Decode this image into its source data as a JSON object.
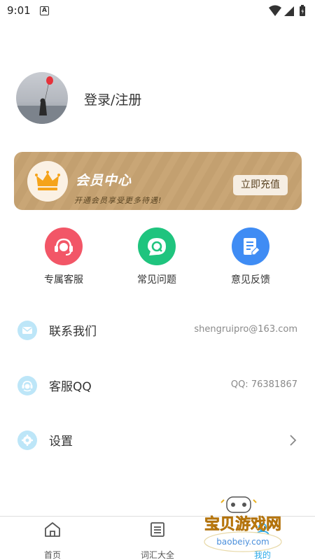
{
  "status_bar": {
    "time": "9:01",
    "notification_badge": "A"
  },
  "profile": {
    "login_label": "登录/注册"
  },
  "vip": {
    "title": "会员中心",
    "subtitle": "开通会员享受更多待遇!",
    "button_label": "立即充值",
    "crown_color": "#f5a31a"
  },
  "quick_actions": [
    {
      "label": "专属客服",
      "icon": "headset-icon",
      "color": "#f25667"
    },
    {
      "label": "常见问题",
      "icon": "chat-q-icon",
      "color": "#1fc47e"
    },
    {
      "label": "意见反馈",
      "icon": "note-edit-icon",
      "color": "#3f8cf4"
    }
  ],
  "rows": [
    {
      "label": "联系我们",
      "value": "shengruipro@163.com",
      "icon": "mail-icon"
    },
    {
      "label": "客服QQ",
      "value": "QQ: 76381867",
      "icon": "support-icon"
    },
    {
      "label": "设置",
      "value": "",
      "icon": "gear-icon"
    }
  ],
  "bottom_nav": [
    {
      "label": "首页",
      "icon": "home-icon"
    },
    {
      "label": "词汇大全",
      "icon": "list-icon"
    },
    {
      "label": "我的",
      "icon": "profile-icon"
    }
  ],
  "watermark": {
    "text": "宝贝游戏网",
    "url_text": "baobeiy.com"
  }
}
